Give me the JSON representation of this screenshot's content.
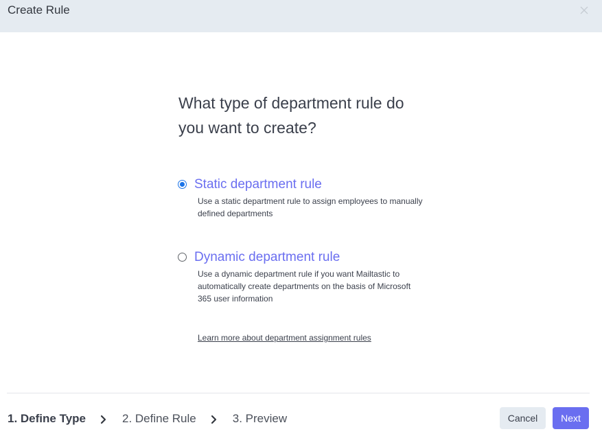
{
  "header": {
    "title": "Create Rule",
    "close_icon": "close-icon"
  },
  "question": "What type of department rule do you want to create?",
  "options": [
    {
      "title": "Static department rule",
      "description": "Use a static department rule to assign employees to manually defined departments",
      "selected": true
    },
    {
      "title": "Dynamic department rule",
      "description": "Use a dynamic department rule if you want Mailtastic to automatically create departments on the basis of Microsoft 365 user information",
      "selected": false
    }
  ],
  "learn_more": "Learn more about department assignment rules",
  "steps": [
    {
      "label": "1. Define Type",
      "active": true
    },
    {
      "label": "2. Define Rule",
      "active": false
    },
    {
      "label": "3. Preview",
      "active": false
    }
  ],
  "step_separator_icon": "chevron-right-icon",
  "buttons": {
    "cancel": "Cancel",
    "next": "Next"
  },
  "colors": {
    "accent": "#6a6ef0",
    "header_bg": "#e5ebf1",
    "radio_selected": "#1a73e8"
  }
}
